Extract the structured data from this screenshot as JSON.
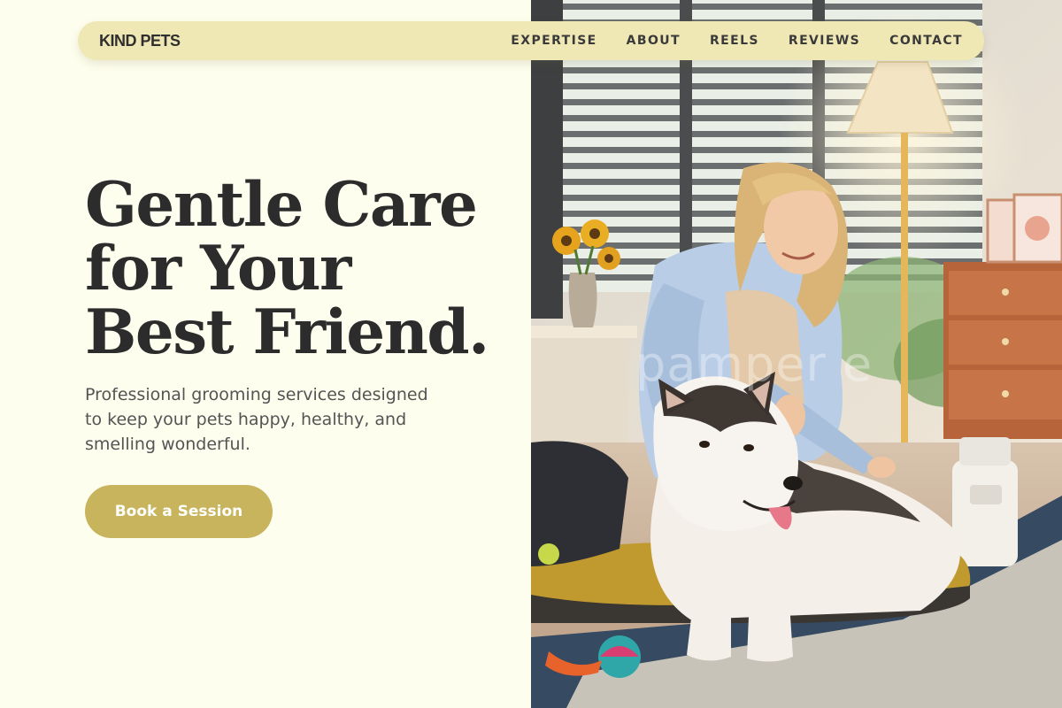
{
  "nav": {
    "brand": "KIND PETS",
    "links": [
      "EXPERTISE",
      "ABOUT",
      "REELS",
      "REVIEWS",
      "CONTACT"
    ]
  },
  "hero": {
    "title_lines": [
      "Gentle Care",
      "for Your",
      "Best Friend."
    ],
    "subtitle_lines": [
      "Professional grooming services designed",
      "to keep your pets happy, healthy, and",
      "smelling wonderful."
    ],
    "cta_label": "Book a Session"
  },
  "photo": {
    "watermark": "pamper e"
  },
  "colors": {
    "page_background": "#fefeee",
    "nav_background": "#f0e8b4",
    "cta_background": "#c8b45c",
    "heading_text": "#2c2c2c"
  },
  "icons": [
    "brand-wordmark"
  ]
}
